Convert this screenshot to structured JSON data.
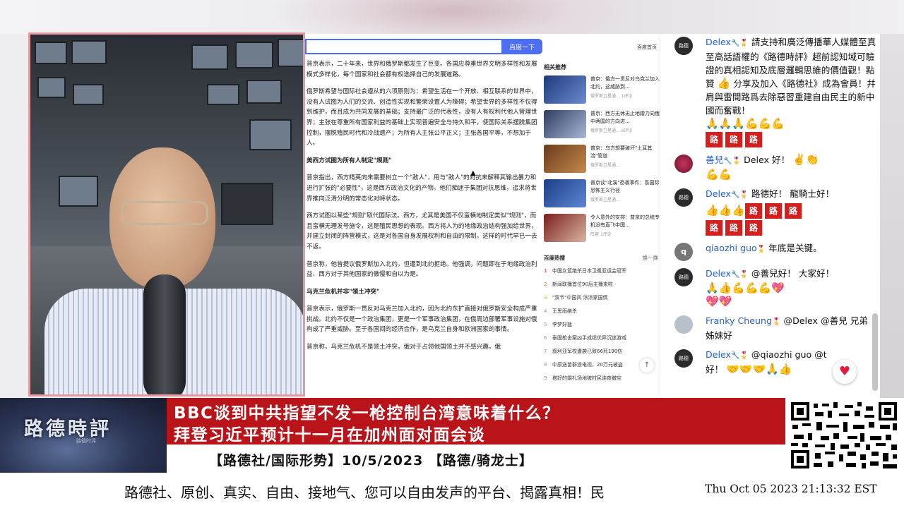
{
  "article": {
    "search_button": "百度一下",
    "paragraphs": [
      "普京表示，二十年来，世界和俄罗斯都发生了巨变。各国应尊重世界文明多样性和发展模式多样化，每个国家和社会都有权选择自己的发展道路。",
      "俄罗斯希望与国际社会遵从的六项原则为：希望生活在一个开放、相互联系的世界中，没有人试图为人们的交流、创造性实现和繁荣设置人为障碍；希望世界的多样性不仅得到维护，而且成为共同发展的基础；支持最广泛的代表性，没有人有权利代他人管理世界；主张在尊重所有国家利益的基础上实现普遍安全与持久和平，使国际关系摆脱集团控制，摆脱殖民时代和冷战遗产；为所有人主张公平正义；主张各国平等，不想加于人。"
    ],
    "heading1": "美西方试图为所有人制定\"规则\"",
    "paragraphs2": [
      "普京指出，西方精英向来需要树立一个\"敌人\"，用与\"敌人\"的对抗来解释其输出暴力和进行扩张的\"必要性\"，这是西方政治文化的产物。他们痴迷于集团对抗思维，追求将世界推向泛滑分明的常态化对峙状态。",
      "西方试图以某些\"规则\"取代国际法。西方，尤其是美国不仅蛮横地制定类似\"规则\"，而且蛮横无理发号施令，这是殖民思想的表现。西方将人为的地缘政治结构强加给世界，并建立封闭的阵营模式，这是对各国自身发展权利和自由的限制。这样的时代早已一去不返。",
      "普京称，他曾提议俄罗斯加入北约，但遭到北约拒绝。他强调，问题即在于地缘政治利益、西方对于其他国家的傲慢和自以为是。"
    ],
    "heading2": "乌克兰危机并非\"领土冲突\"",
    "paragraphs3": [
      "普京表示，俄罗斯一贯反对乌克兰加入北约，因为北约东扩直接对俄罗斯安全构成严重挑战。北约不仅是一个政治集团，更是一个军事政治集团，在俄周边部署军事设施对俄构成了严重威胁。至于各国间的经济合作，是乌克兰自身和欧洲国家的事情。",
      "普京称，乌克兰危机不是领土冲突，俄对于占领他国领土并不感兴趣，俄"
    ]
  },
  "related": {
    "home_link": "百度首页",
    "title": "相关推荐",
    "items": [
      {
        "title": "普京：俄方一贯反对乌克兰加入北约，这威胁到...",
        "source": "俄罗斯卫星通...",
        "comments": "1评论"
      },
      {
        "title": "普京：西方无休无止地蹭力向俄中两国的方向进...",
        "source": "俄罗斯卫星通...",
        "comments": "6评论"
      },
      {
        "title": "普京：乌方想要破坏\"土耳其流\"管道",
        "source": "俄罗斯卫星通...",
        "comments": ""
      },
      {
        "title": "普京谈\"北溪\"恐袭事件：系国际恐怖主义行径",
        "source": "俄罗斯卫星通...",
        "comments": ""
      },
      {
        "title": "令人意外的安排：普京的总统专机没有直飞中国...",
        "source": "阵营",
        "comments": "1评论"
      }
    ],
    "hot_title": "百度热搜",
    "hot_refresh": "换一换",
    "hot_items": [
      {
        "n": "1",
        "text": "中国女篮绝杀日本卫冕亚运会冠军"
      },
      {
        "n": "2",
        "text": "新闻联播首位90后主播来啦"
      },
      {
        "n": "3",
        "text": "\"双节\"中国风 浓浓家国情"
      },
      {
        "n": "4",
        "text": "王思雨绝杀"
      },
      {
        "n": "5",
        "text": "李梦好猛"
      },
      {
        "n": "6",
        "text": "泰国枪击案凶手成绩优异沉迷游戏"
      },
      {
        "n": "7",
        "text": "叙利亚军校遭袭已致66死190伤"
      },
      {
        "n": "8",
        "text": "中原送苗群遥电视，20万元被盗"
      },
      {
        "n": "9",
        "text": "搭好的婚礼场地被村民连夜撤空"
      }
    ]
  },
  "chat": {
    "messages": [
      {
        "author": "Delex",
        "avatar": "路德",
        "text": "請支持和廣泛傳播華人媒體至真至高話語權的《路德時評》超前認知域可驗證的真相認知及底層邏輯思維的價值觀！點贊",
        "text2": "分享及加入《路德社》成為會員！幷肩與雷間路爲去除惡習重建自由民主的新中國而奮戰！"
      },
      {
        "author": "善兒",
        "avatar": "",
        "text": "Delex 好！"
      },
      {
        "author": "Delex",
        "avatar": "路德",
        "text": "路德好！ 龍騎士好！"
      },
      {
        "author": "qiaozhi guo",
        "avatar": "q",
        "text": "年底是关键。"
      },
      {
        "author": "Delex",
        "avatar": "路德",
        "text": "@善兒好！ 大家好！"
      },
      {
        "author": "Franky Cheung",
        "avatar": "",
        "text": "@Delex @善兒 兄弟姊妹好"
      },
      {
        "author": "Delex",
        "avatar": "路德",
        "text": "@qiaozhi guo @t",
        "text2": "好！"
      }
    ],
    "lu_char": "路"
  },
  "banner": {
    "logo": "路德時評",
    "logo_sub": "路德时评",
    "headline1": "BBC谈到中共指望不发一枪控制台湾意味着什么？",
    "headline2": "拜登习近平预计十一月在加州面对面会谈",
    "subline": "【路德社/国际形势】10/5/2023 【路德/骑龙士】"
  },
  "ticker": {
    "text": "路德社、原创、真实、自由、接地气、您可以自由发声的平台、揭露真相！民",
    "time": "Thu Oct 05 2023 21:13:32 EST"
  },
  "colors": {
    "accent": "#4e6ef2",
    "banner_red": "#b8141a",
    "chat_author": "#2260d0"
  }
}
